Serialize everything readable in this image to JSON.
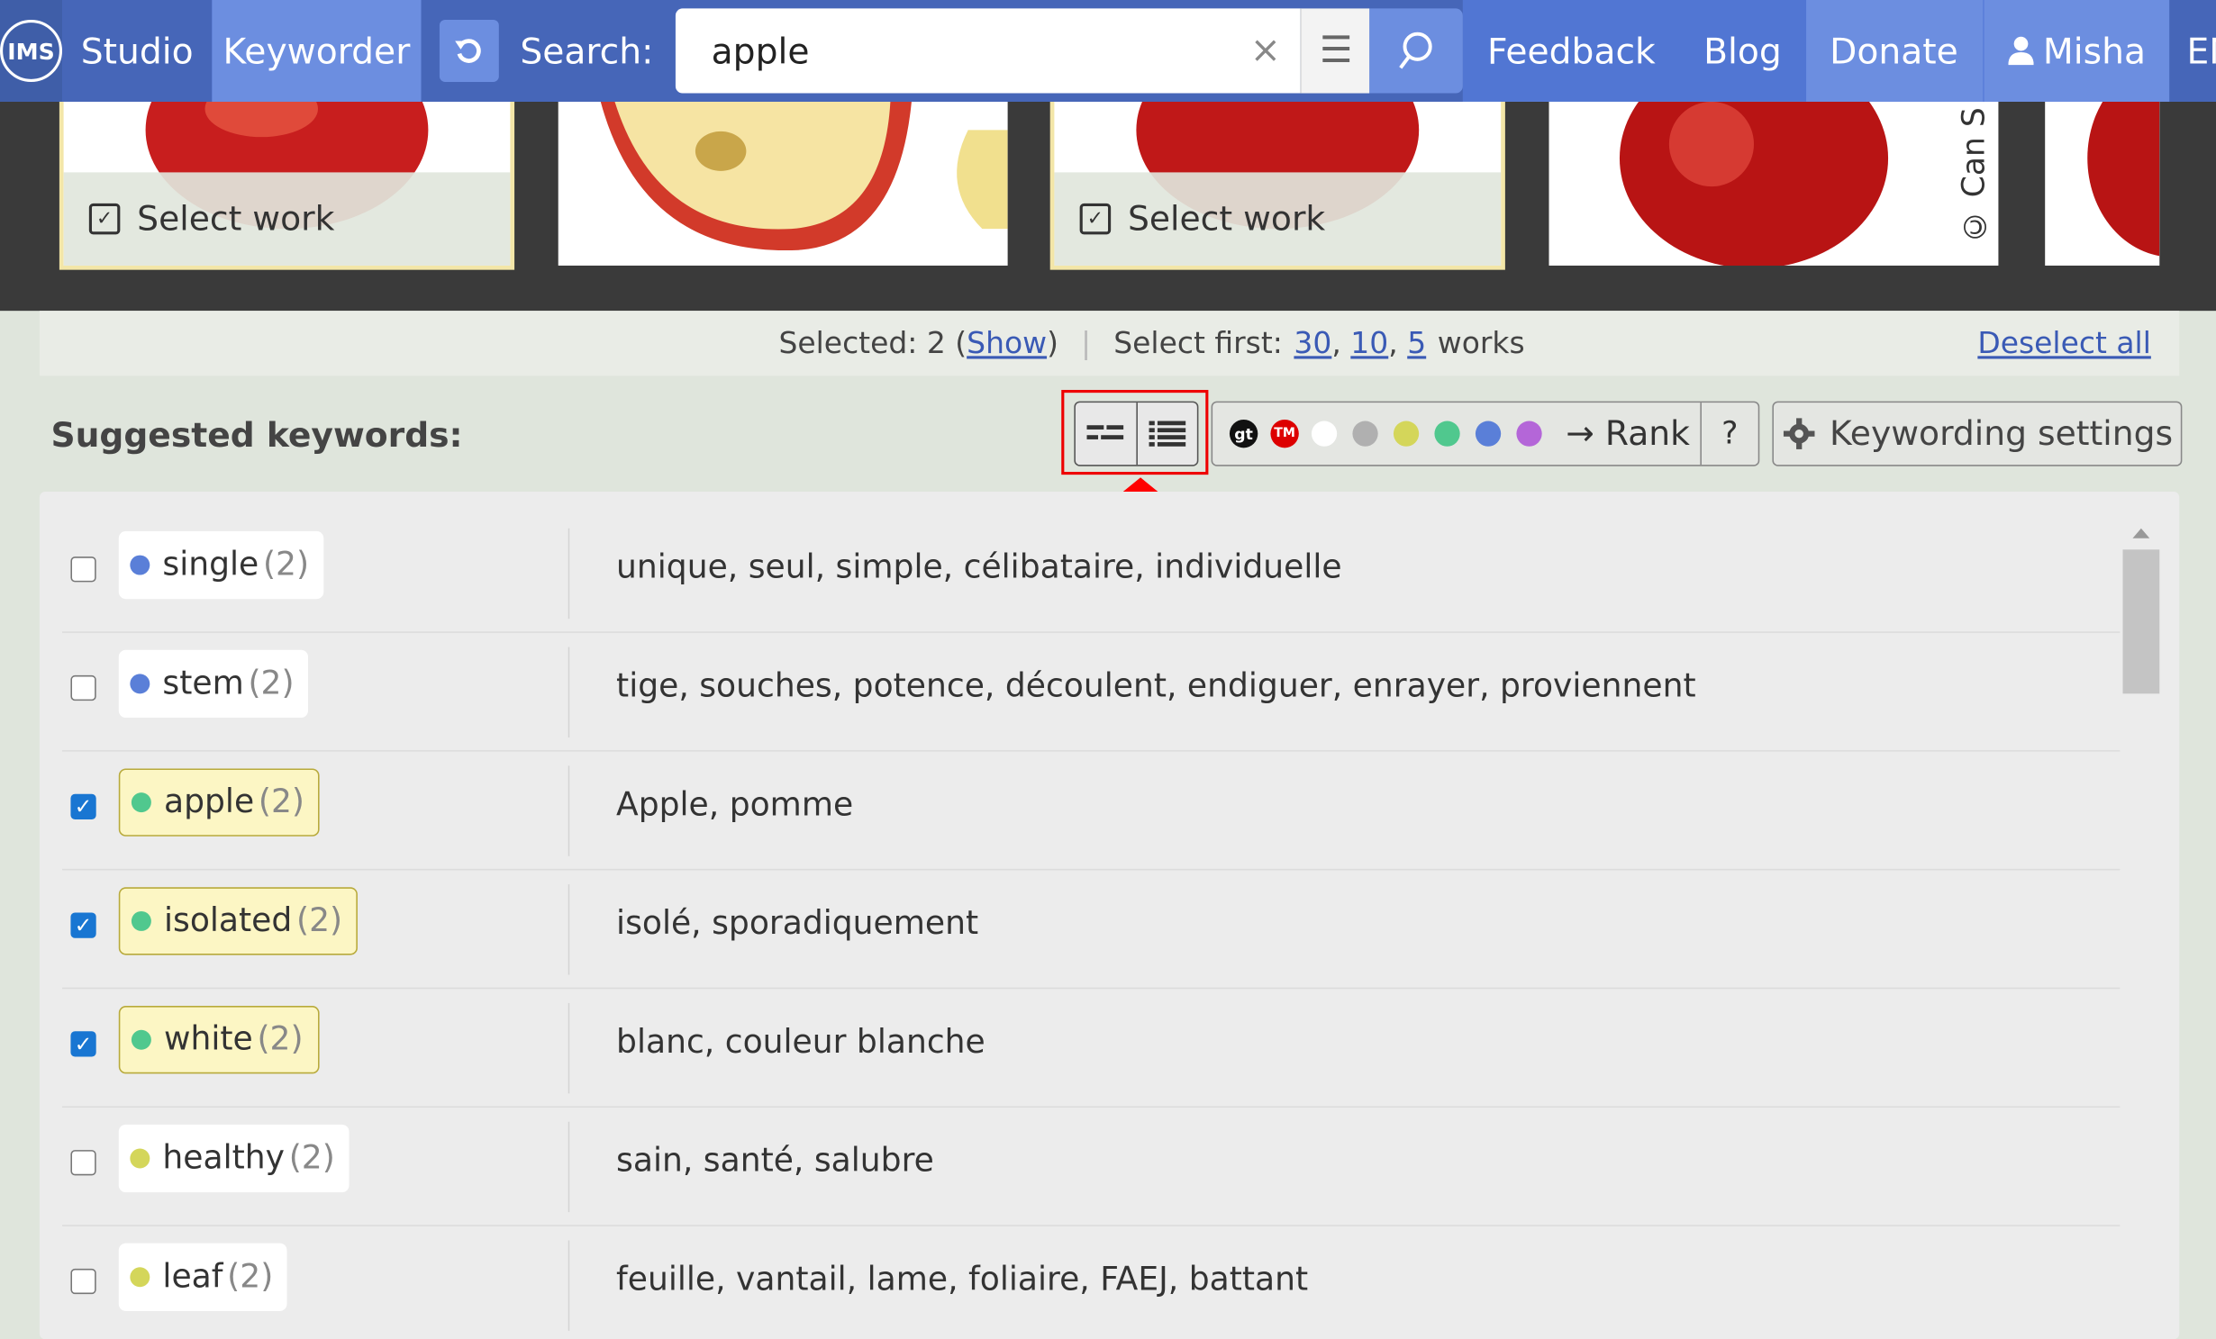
{
  "nav": {
    "logo": "IMS",
    "studio": "Studio",
    "keyworder": "Keyworder",
    "search_label": "Search:",
    "search_value": "apple",
    "clear_icon": "close-icon",
    "feedback": "Feedback",
    "blog": "Blog",
    "donate": "Donate",
    "user": "Misha",
    "lang": "EN"
  },
  "thumbs": [
    {
      "selected": true,
      "label": "Select work"
    },
    {
      "selected": false
    },
    {
      "selected": true,
      "label": "Select work"
    },
    {
      "selected": false,
      "credit": "© Can S"
    },
    {
      "selected": false
    }
  ],
  "selection": {
    "selected_prefix": "Selected: 2 (",
    "show_link": "Show",
    "selected_suffix": ")",
    "select_first": "Select first:",
    "opt_30": "30",
    "opt_10": "10",
    "opt_5": "5",
    "works": "works",
    "deselect": "Deselect all"
  },
  "toolbar": {
    "title": "Suggested keywords:",
    "gt": "gt",
    "tm": "TM",
    "rank": "→ Rank",
    "help": "?",
    "settings": "Keywording settings"
  },
  "colors": {
    "accent": "#5176d3",
    "dot_white": "#ffffff",
    "dot_gray": "#b0b0b0",
    "dot_yellow": "#d4d65a",
    "dot_green": "#50c88e",
    "dot_blue": "#5a7fd8",
    "dot_purple": "#b466d8"
  },
  "keywords": [
    {
      "word": "single",
      "count": "(2)",
      "checked": false,
      "dot": "#5a7fd8",
      "trans": "unique, seul, simple, célibataire, individuelle"
    },
    {
      "word": "stem",
      "count": "(2)",
      "checked": false,
      "dot": "#5a7fd8",
      "trans": "tige, souches, potence, découlent, endiguer, enrayer, proviennent"
    },
    {
      "word": "apple",
      "count": "(2)",
      "checked": true,
      "dot": "#50c88e",
      "trans": "Apple, pomme"
    },
    {
      "word": "isolated",
      "count": "(2)",
      "checked": true,
      "dot": "#50c88e",
      "trans": "isolé, sporadiquement"
    },
    {
      "word": "white",
      "count": "(2)",
      "checked": true,
      "dot": "#50c88e",
      "trans": "blanc, couleur blanche"
    },
    {
      "word": "healthy",
      "count": "(2)",
      "checked": false,
      "dot": "#d4d65a",
      "trans": "sain, santé, salubre"
    },
    {
      "word": "leaf",
      "count": "(2)",
      "checked": false,
      "dot": "#d4d65a",
      "trans": "feuille, vantail, lame, foliaire, FAEJ, battant"
    }
  ]
}
